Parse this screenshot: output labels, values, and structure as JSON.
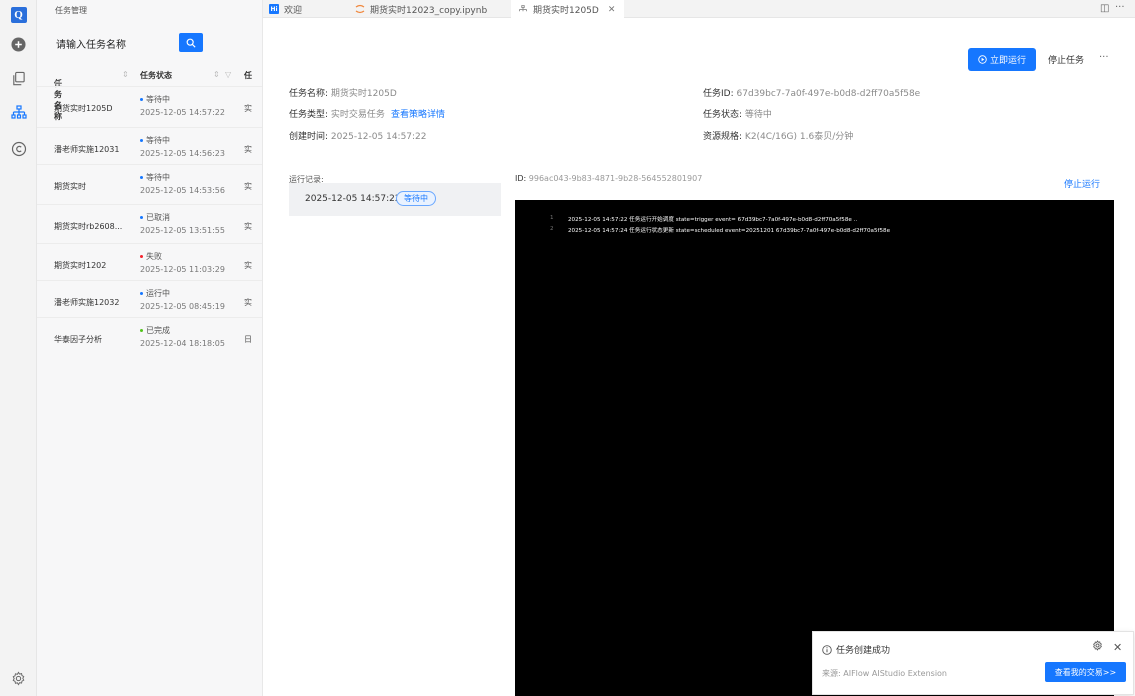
{
  "activity": {
    "logo": "Q",
    "icons": [
      "plus-circle-icon",
      "copy-icon",
      "org-chart-icon",
      "copyright-icon",
      "settings-icon"
    ]
  },
  "sidebar": {
    "title": "任务管理",
    "search_placeholder": "请输入任务名称",
    "columns": {
      "name": "任务名称",
      "status": "任务状态",
      "type": "任"
    },
    "rows": [
      {
        "name": "期货实时1205D",
        "status": "等待中",
        "status_color": "#1677ff",
        "time": "2025-12-05 14:57:22",
        "type": "实"
      },
      {
        "name": "潘老师实施12031",
        "status": "等待中",
        "status_color": "#1677ff",
        "time": "2025-12-05 14:56:23",
        "type": "实"
      },
      {
        "name": "期货实时",
        "status": "等待中",
        "status_color": "#1677ff",
        "time": "2025-12-05 14:53:56",
        "type": "实"
      },
      {
        "name": "期货实时rb2608...",
        "status": "已取消",
        "status_color": "#1677ff",
        "time": "2025-12-05 13:51:55",
        "type": "实"
      },
      {
        "name": "期货实时1202",
        "status": "失败",
        "status_color": "#f5222d",
        "time": "2025-12-05 11:03:29",
        "type": "实"
      },
      {
        "name": "潘老师实施12032",
        "status": "运行中",
        "status_color": "#1677ff",
        "time": "2025-12-05 08:45:19",
        "type": "实"
      },
      {
        "name": "华泰因子分析",
        "status": "已完成",
        "status_color": "#52c41a",
        "time": "2025-12-04 18:18:05",
        "type": "日"
      }
    ]
  },
  "tabs": [
    {
      "label": "欢迎",
      "icon": "Hi"
    },
    {
      "label": "期货实时12023_copy.ipynb"
    },
    {
      "label": "期货实时1205D"
    }
  ],
  "detail": {
    "run_now": "立即运行",
    "stop_task": "停止任务",
    "more": "···",
    "name_label": "任务名称:",
    "name_value": "期货实时1205D",
    "type_label": "任务类型:",
    "type_value": "实时交易任务",
    "strategy_link": "查看策略详情",
    "created_label": "创建时间:",
    "created_value": "2025-12-05 14:57:22",
    "id_label": "任务ID:",
    "id_value": "67d39bc7-7a0f-497e-b0d8-d2ff70a5f58e",
    "status_label": "任务状态:",
    "status_value": "等待中",
    "spec_label": "资源规格:",
    "spec_value": "K2(4C/16G) 1.6泰贝/分钟"
  },
  "runs": {
    "label": "运行记录:",
    "items": [
      {
        "time": "2025-12-05 14:57:22",
        "status": "等待中"
      }
    ],
    "run_id_label": "ID:",
    "run_id": "996ac043-9b83-4871-9b28-564552801907",
    "stop_run": "停止运行"
  },
  "console": [
    {
      "n": "1",
      "text": "2025-12-05 14:57:22 任务运行开始调度 state=trigger event= 67d39bc7-7a0f-497e-b0d8-d2ff70a5f58e .."
    },
    {
      "n": "2",
      "text": "2025-12-05 14:57:24 任务运行状态更新 state=scheduled event=20251201 67d39bc7-7a0f-497e-b0d8-d2ff70a5f58e"
    }
  ],
  "toast": {
    "message": "任务创建成功",
    "source": "来源: AIFlow AIStudio Extension",
    "button": "查看我的交易>>"
  }
}
